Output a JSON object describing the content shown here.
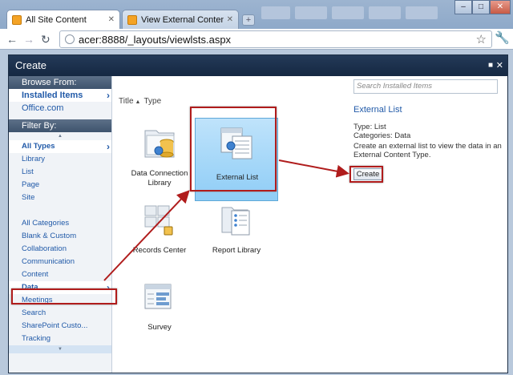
{
  "browser": {
    "tabs": [
      {
        "title": "All Site Content",
        "active": true
      },
      {
        "title": "View External Content Ty...",
        "active": false
      }
    ],
    "new_tab_glyph": "+",
    "address": "acer:8888/_layouts/viewlsts.aspx",
    "window_controls": {
      "minimize": "–",
      "maximize": "□",
      "close": "✕"
    }
  },
  "dialog": {
    "title": "Create",
    "browse_header": "Browse From:",
    "browse_items": [
      {
        "label": "Installed Items",
        "selected": true
      },
      {
        "label": "Office.com",
        "selected": false
      }
    ],
    "filter_header": "Filter By:",
    "filter_types": [
      "All Types",
      "Library",
      "List",
      "Page",
      "Site"
    ],
    "filter_categories": [
      "All Categories",
      "Blank & Custom",
      "Collaboration",
      "Communication",
      "Content",
      "Data",
      "Meetings",
      "Search",
      "SharePoint Custo...",
      "Tracking"
    ],
    "sort": {
      "title": "Title",
      "type": "Type"
    },
    "tiles": [
      {
        "name": "Data Connection Library",
        "icon": "data-connection-library-icon",
        "selected": false
      },
      {
        "name": "External List",
        "icon": "external-list-icon",
        "selected": true
      },
      {
        "name": "Records Center",
        "icon": "records-center-icon",
        "selected": false
      },
      {
        "name": "Report Library",
        "icon": "report-library-icon",
        "selected": false
      },
      {
        "name": "Survey",
        "icon": "survey-icon",
        "selected": false
      }
    ],
    "search_placeholder": "Search Installed Items",
    "detail": {
      "title": "External List",
      "type": "Type: List",
      "categories": "Categories: Data",
      "description": "Create an external list to view the data in an External Content Type.",
      "create_label": "Create"
    }
  },
  "colors": {
    "accent": "#215aa8",
    "highlight": "#b01c1c",
    "header": "#152842"
  }
}
